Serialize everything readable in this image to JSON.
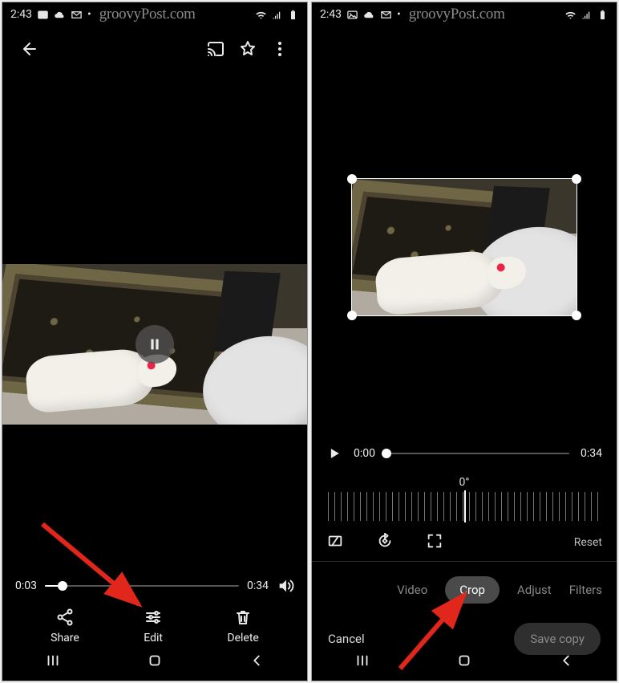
{
  "status": {
    "time": "2:43"
  },
  "watermark": "groovyPost.com",
  "left": {
    "playback": {
      "current": "0:03",
      "duration": "0:34",
      "progress_pct": 9
    },
    "actions": {
      "share": "Share",
      "edit": "Edit",
      "delete": "Delete"
    }
  },
  "right": {
    "playback": {
      "current": "0:00",
      "duration": "0:34",
      "progress_pct": 0
    },
    "angle": "0°",
    "reset": "Reset",
    "tabs": {
      "video": "Video",
      "crop": "Crop",
      "adjust": "Adjust",
      "filters": "Filters"
    },
    "cancel": "Cancel",
    "save": "Save copy"
  }
}
